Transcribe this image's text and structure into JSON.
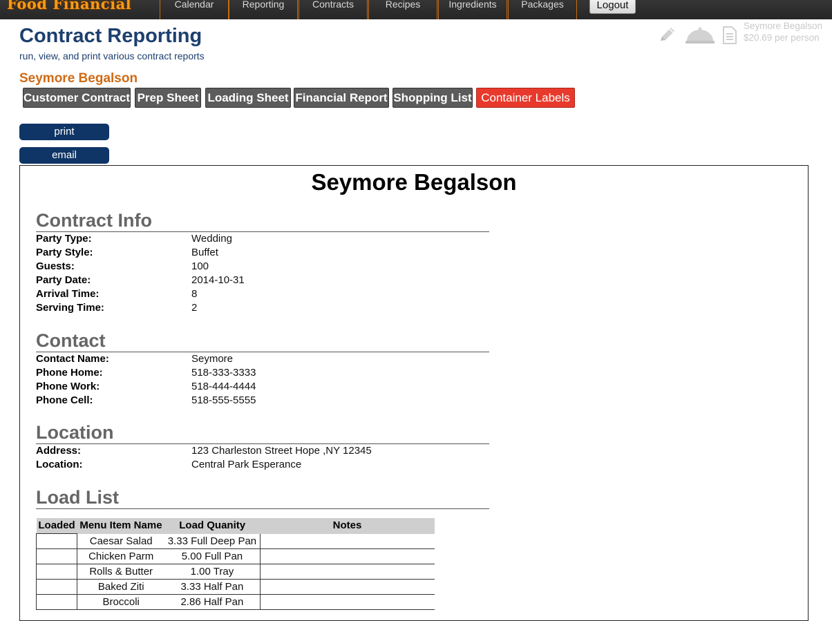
{
  "app": {
    "logo_text": "Food Financial"
  },
  "nav": {
    "items": [
      {
        "label": "Calendar"
      },
      {
        "label": "Reporting"
      },
      {
        "label": "Contracts"
      },
      {
        "label": "Recipes"
      },
      {
        "label": "Ingredients"
      },
      {
        "label": "Packages"
      }
    ],
    "logout_label": "Logout"
  },
  "header": {
    "title": "Contract Reporting",
    "subtitle": "run, view, and print various contract reports",
    "icons": [
      "pencil-icon",
      "serving-cloche-icon",
      "document-icon"
    ]
  },
  "user_info": {
    "name": "Seymore Begalson",
    "price": "$20.69 per person"
  },
  "client_name": "Seymore Begalson",
  "report_tabs": [
    {
      "label": "Customer Contract",
      "active": false
    },
    {
      "label": "Prep Sheet",
      "active": false
    },
    {
      "label": "Loading Sheet",
      "active": false
    },
    {
      "label": "Financial Report",
      "active": false
    },
    {
      "label": "Shopping List",
      "active": false
    },
    {
      "label": "Container Labels",
      "active": true
    }
  ],
  "actions": {
    "print_label": "print",
    "email_label": "email"
  },
  "report": {
    "title": "Seymore Begalson",
    "contract_info": {
      "heading": "Contract Info",
      "fields": [
        {
          "label": "Party Type:",
          "value": "Wedding"
        },
        {
          "label": "Party Style:",
          "value": "Buffet"
        },
        {
          "label": "Guests:",
          "value": "100"
        },
        {
          "label": "Party Date:",
          "value": "2014-10-31"
        },
        {
          "label": "Arrival Time:",
          "value": "8"
        },
        {
          "label": "Serving Time:",
          "value": "2"
        }
      ]
    },
    "contact": {
      "heading": "Contact",
      "fields": [
        {
          "label": "Contact Name:",
          "value": "Seymore"
        },
        {
          "label": "Phone Home:",
          "value": "518-333-3333"
        },
        {
          "label": "Phone Work:",
          "value": "518-444-4444"
        },
        {
          "label": "Phone Cell:",
          "value": "518-555-5555"
        }
      ]
    },
    "location": {
      "heading": "Location",
      "fields": [
        {
          "label": "Address:",
          "value": "123 Charleston Street Hope ,NY 12345"
        },
        {
          "label": "Location:",
          "value": "Central Park Esperance"
        }
      ]
    },
    "load_list": {
      "heading": "Load List",
      "columns": [
        "Loaded",
        "Menu Item Name",
        "Load Quanity",
        "Notes"
      ],
      "rows": [
        {
          "name": "Caesar Salad",
          "quantity": "3.33 Full Deep Pan",
          "notes": ""
        },
        {
          "name": "Chicken Parm",
          "quantity": "5.00 Full Pan",
          "notes": ""
        },
        {
          "name": "Rolls & Butter",
          "quantity": "1.00 Tray",
          "notes": ""
        },
        {
          "name": "Baked Ziti",
          "quantity": "3.33 Half Pan",
          "notes": ""
        },
        {
          "name": "Broccoli",
          "quantity": "2.86 Half Pan",
          "notes": ""
        }
      ]
    }
  },
  "colors": {
    "accent_orange": "#cf6a14",
    "title_blue": "#1c3f6e",
    "active_tab": "#e83a2c",
    "tab_gray": "#5c5c5c",
    "button_navy": "#0f3566"
  }
}
